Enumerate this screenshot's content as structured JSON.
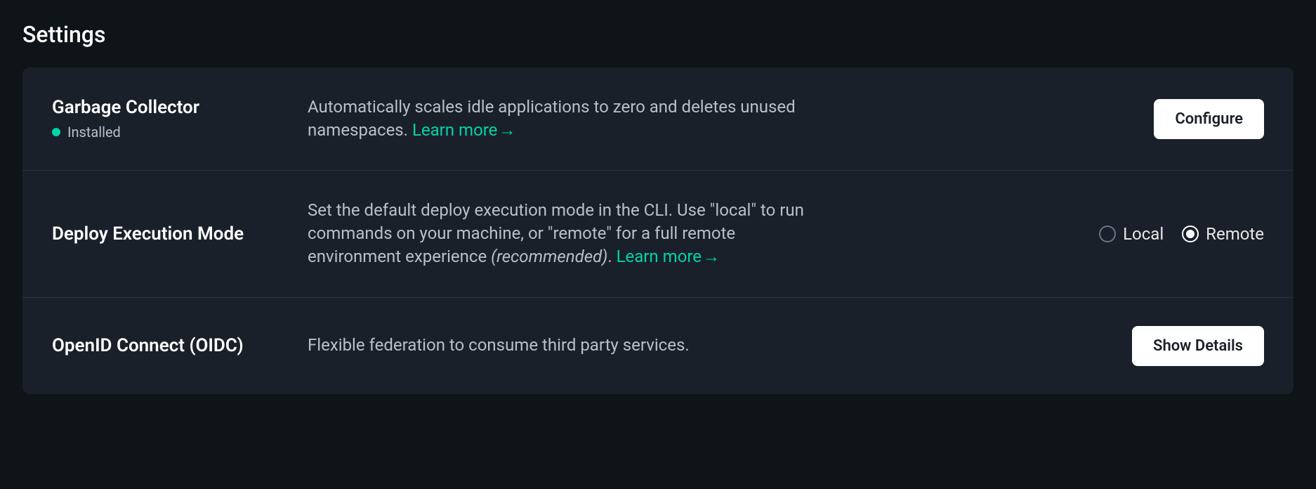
{
  "page": {
    "title": "Settings"
  },
  "settings": {
    "garbage_collector": {
      "title": "Garbage Collector",
      "status": "Installed",
      "description": "Automatically scales idle applications to zero and deletes unused namespaces. ",
      "learn_more": "Learn more",
      "button": "Configure"
    },
    "deploy_mode": {
      "title": "Deploy Execution Mode",
      "description_part1": "Set the default deploy execution mode in the CLI. Use \"local\" to run commands on your machine, or \"remote\" for a full remote environment experience ",
      "description_italic": "(recommended)",
      "description_part2": ". ",
      "learn_more": "Learn more",
      "option_local": "Local",
      "option_remote": "Remote",
      "selected": "remote"
    },
    "oidc": {
      "title": "OpenID Connect (OIDC)",
      "description": "Flexible federation to consume third party services.",
      "button": "Show Details"
    }
  }
}
